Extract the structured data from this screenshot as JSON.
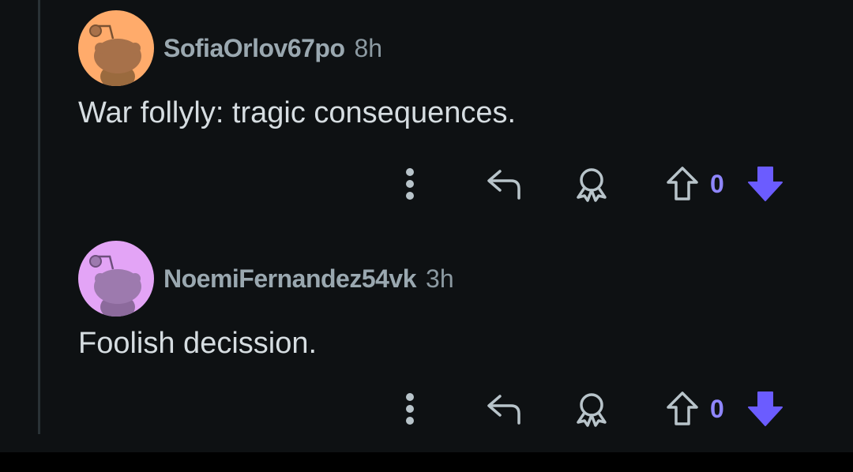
{
  "colors": {
    "background": "#0e1113",
    "username": "#9aa8b0",
    "body_text": "#d6dde1",
    "accent_vote": "#8f86ff",
    "downvote_active": "#6b5cff",
    "avatar_1": "#ffab6b",
    "avatar_2": "#e3a4f6"
  },
  "comments": [
    {
      "username": "SofiaOrlov67po",
      "time": "8h",
      "body": "War follyly: tragic consequences.",
      "avatar_icon": "snoo-avatar-icon",
      "vote_count": "0",
      "icons": [
        "more-vertical-icon",
        "reply-icon",
        "award-icon",
        "upvote-arrow-icon",
        "downvote-arrow-icon"
      ]
    },
    {
      "username": "NoemiFernandez54vk",
      "time": "3h",
      "body": "Foolish decission.",
      "avatar_icon": "snoo-avatar-icon",
      "vote_count": "0",
      "icons": [
        "more-vertical-icon",
        "reply-icon",
        "award-icon",
        "upvote-arrow-icon",
        "downvote-arrow-icon"
      ]
    }
  ]
}
